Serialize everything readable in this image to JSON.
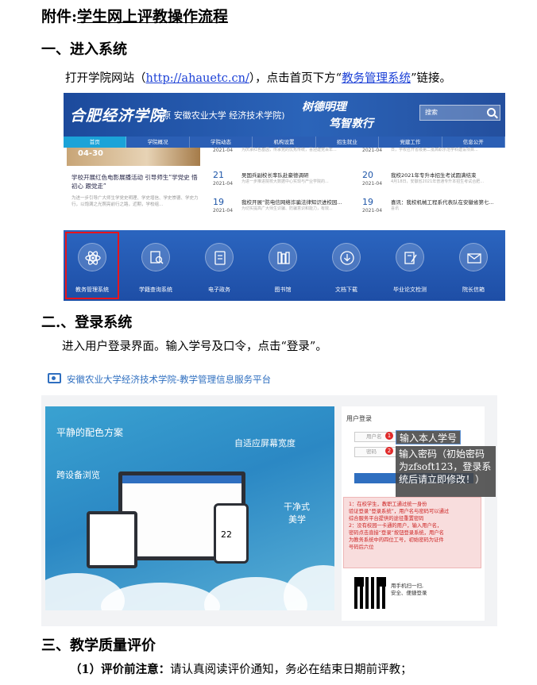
{
  "doc": {
    "title_prefix": "附件:",
    "title_main": "学生网上评教操作流程",
    "section1": {
      "heading": "一、进入系统",
      "text_before": "打开学院网站（",
      "link": "http://ahauetc.cn/",
      "text_mid": "），点击首页下方“",
      "link2": "教务管理系统",
      "text_after": "”链接。"
    },
    "section2": {
      "heading": "二.、登录系统",
      "text": "进入用户登录界面。输入学号及口令，点击“登录”。"
    },
    "section3": {
      "heading": "三、教学质量评价",
      "item1_label": "（1）评价前注意：",
      "item1_text": "请认真阅读评价通知，务必在结束日期前评教；"
    }
  },
  "website": {
    "logo": "合肥经济学院",
    "logo_sub": "(原 安徽农业大学 经济技术学院)",
    "motto_line1": "树德明理",
    "motto_line2": "笃智敦行",
    "search_placeholder": "搜索",
    "nav": [
      "首页",
      "学院概况",
      "学院动态",
      "机构设置",
      "招生就业",
      "党建工作",
      "信息公开"
    ],
    "featured": {
      "date": "04-30",
      "title": "学校开展红色电影展播活动 引导师生“学党史 悟初心 跟党走”",
      "desc": "为进一步引导广大师生学党史明理、学史增信、学史崇德、学史力行，以饱满之光照亮前行之路，近期，学校组..."
    },
    "news": [
      {
        "day": "",
        "ym": "2021-04",
        "title": "为庆祝红色基因、传承党的优秀传统",
        "sub": "为庆承红色基因，传承党的优秀传统，喜迎建党百年..."
      },
      {
        "day": "21",
        "ym": "2021-04",
        "title": "吴国兵副校长率队赴豪德调研",
        "sub": "为进一步推进院校大数据中心实现与产业学院的..."
      },
      {
        "day": "19",
        "ym": "2021-04",
        "title": "我校开展“防电信网络诈骗法律知识进校园...",
        "sub": "为切实提高广大师生识骗、防骗意识和能力，有效..."
      },
      {
        "day": "",
        "ym": "2021-04",
        "title": "学校举行省级教学团队评审会",
        "sub": "日，学校召开省级第二批高职示范学科建设项目..."
      },
      {
        "day": "20",
        "ym": "2021-04",
        "title": "我校2021年专升本招生考试圆满结束",
        "sub": "4月18日，安徽省2021年普通专升本招生考试合肥..."
      },
      {
        "day": "19",
        "ym": "2021-04",
        "title": "喜讯：我校机械工程系代表队在安徽省第七...",
        "sub": "喜讯"
      }
    ],
    "tiles": [
      "教务管理系统",
      "学籍查询系统",
      "电子政务",
      "图书馆",
      "文档下载",
      "毕业论文检测",
      "院长信箱"
    ]
  },
  "login_page": {
    "platform_title": "安徽农业大学经济技术学院-教学管理信息服务平台",
    "hero_phrases": [
      "平静的配色方案",
      "自适应屏幕宽度",
      "跨设备浏览",
      "干净式",
      "美学"
    ],
    "monitor_date": "22",
    "panel_title": "用户登录",
    "username_placeholder": "用户名",
    "password_placeholder": "密码",
    "badge1": "1",
    "badge2": "2",
    "tip1": "输入本人学号",
    "tip2": "输入密码（初始密码为zfsoft123，登录系统后请立即修改！）",
    "notice": "1：在校学生，教职工通过统一身份\n验证登录“登录系统”，用户名与密码可以通过\n综合服务平台提供的途径重置密码\n2：没有校园一卡通的用户，输入用户名，\n密码点击直接“登录”按钮登录系统，用户名\n为教务系统中的四位工号，初始密码为证件\n号码后六位",
    "qr_text": "用手机扫一扫,\n安全、便捷登录"
  },
  "colors": {
    "site_blue": "#2b5fb5",
    "highlight_red": "#e8141b",
    "link_blue": "#1a3fd6",
    "platform_blue": "#2f6fc0"
  }
}
